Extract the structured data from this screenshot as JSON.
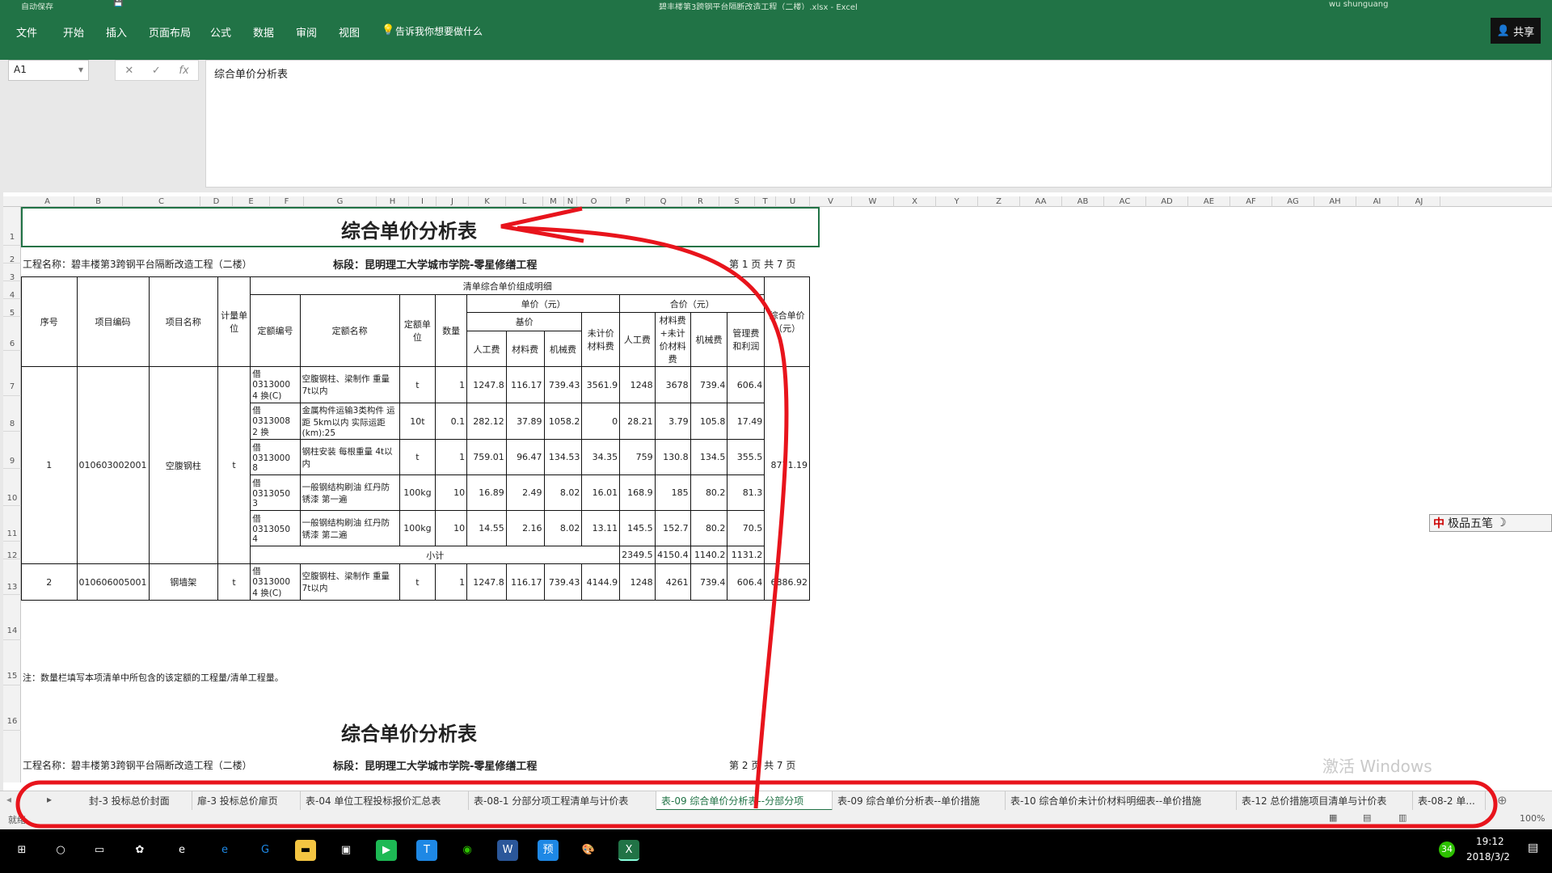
{
  "titlebar": {
    "autosave": "自动保存",
    "filename": "碧丰楼第3跨钢平台隔断改造工程（二楼）.xlsx - Excel",
    "user": "wu shunguang"
  },
  "ribbon": {
    "tabs": [
      "文件",
      "开始",
      "插入",
      "页面布局",
      "公式",
      "数据",
      "审阅",
      "视图"
    ],
    "tellme": "告诉我你想要做什么",
    "share": "共享"
  },
  "formula": {
    "cell": "A1",
    "content": "综合单价分析表"
  },
  "columns": [
    "A",
    "B",
    "C",
    "D",
    "E",
    "F",
    "G",
    "H",
    "I",
    "J",
    "K",
    "L",
    "M",
    "N",
    "O",
    "P",
    "Q",
    "R",
    "S",
    "T",
    "U",
    "V",
    "W",
    "X",
    "Y",
    "Z",
    "AA",
    "AB",
    "AC",
    "AD",
    "AE",
    "AF",
    "AG",
    "AH",
    "AI",
    "AJ"
  ],
  "rows": [
    "1",
    "2",
    "3",
    "4",
    "5",
    "6",
    "7",
    "8",
    "9",
    "10",
    "11",
    "12",
    "13",
    "14",
    "15",
    "16"
  ],
  "sheet": {
    "title": "综合单价分析表",
    "project": "工程名称：碧丰楼第3跨钢平台隔断改造工程（二楼）",
    "section": "标段：昆明理工大学城市学院-零星修缮工程",
    "page1": "第 1 页  共 7 页",
    "page2": "第 2 页  共 7 页",
    "hdr": {
      "detail": "清单综合单价组成明细",
      "seq": "序号",
      "code": "项目编码",
      "name": "项目名称",
      "unit": "计量单位",
      "qcode": "定额编号",
      "qname": "定额名称",
      "qunit": "定额单位",
      "qty": "数量",
      "price": "单价（元）",
      "total": "合价（元）",
      "base": "基价",
      "labor": "人工费",
      "mat": "材料费",
      "mach": "机械费",
      "unpriced": "未计价材料费",
      "labor2": "人工费",
      "mat2": "材料费+未计价材料费",
      "mach2": "机械费",
      "mgmt": "管理费和利润",
      "comp": "综合单价（元）"
    },
    "items": [
      {
        "seq": "1",
        "code": "010603002001",
        "name": "空腹钢柱",
        "unit": "t",
        "comp": "8771.19",
        "rows": [
          [
            "借0313000 4 换(C)",
            "空腹钢柱、梁制作 重量 7t以内",
            "t",
            "1",
            "1247.8",
            "116.17",
            "739.43",
            "3561.9",
            "1248",
            "3678",
            "739.4",
            "606.4"
          ],
          [
            "借0313008 2 换",
            "金属构件运输3类构件 运距 5km以内 实际运距(km):25",
            "10t",
            "0.1",
            "282.12",
            "37.89",
            "1058.2",
            "0",
            "28.21",
            "3.79",
            "105.8",
            "17.49"
          ],
          [
            "借0313000 8",
            "钢柱安装 每根重量 4t以内",
            "t",
            "1",
            "759.01",
            "96.47",
            "134.53",
            "34.35",
            "759",
            "130.8",
            "134.5",
            "355.5"
          ],
          [
            "借0313050 3",
            "一般钢结构刷油 红丹防锈漆 第一遍",
            "100kg",
            "10",
            "16.89",
            "2.49",
            "8.02",
            "16.01",
            "168.9",
            "185",
            "80.2",
            "81.3"
          ],
          [
            "借0313050 4",
            "一般钢结构刷油 红丹防锈漆 第二遍",
            "100kg",
            "10",
            "14.55",
            "2.16",
            "8.02",
            "13.11",
            "145.5",
            "152.7",
            "80.2",
            "70.5"
          ]
        ],
        "subtotal": {
          "label": "小计",
          "vals": [
            "2349.5",
            "4150.4",
            "1140.2",
            "1131.2"
          ]
        }
      },
      {
        "seq": "2",
        "code": "010606005001",
        "name": "钢墙架",
        "unit": "t",
        "comp": "6886.92",
        "rows": [
          [
            "借0313000 4 换(C)",
            "空腹钢柱、梁制作 重量 7t以内",
            "t",
            "1",
            "1247.8",
            "116.17",
            "739.43",
            "4144.9",
            "1248",
            "4261",
            "739.4",
            "606.4"
          ]
        ]
      }
    ],
    "note": "注：数量栏填写本项清单中所包含的该定额的工程量/清单工程量。"
  },
  "tabs": [
    "封-3 投标总价封面",
    "扉-3 投标总价扉页",
    "表-04 单位工程投标报价汇总表",
    "表-08-1 分部分项工程清单与计价表",
    "表-09 综合单价分析表--分部分项",
    "表-09 综合单价分析表--单价措施",
    "表-10 综合单价未计价材料明细表--单价措施",
    "表-12 总价措施项目清单与计价表",
    "表-08-2 单..."
  ],
  "active_tab": "表-09 综合单价分析表--分部分项",
  "status": {
    "ready": "就绪",
    "zoom": "100%"
  },
  "taskbar": {
    "time": "19:12",
    "date": "2018/3/2",
    "badge": "34"
  },
  "ime": "极品五笔",
  "watermark": "激活 Windows",
  "annotation_color": "#e8141c"
}
